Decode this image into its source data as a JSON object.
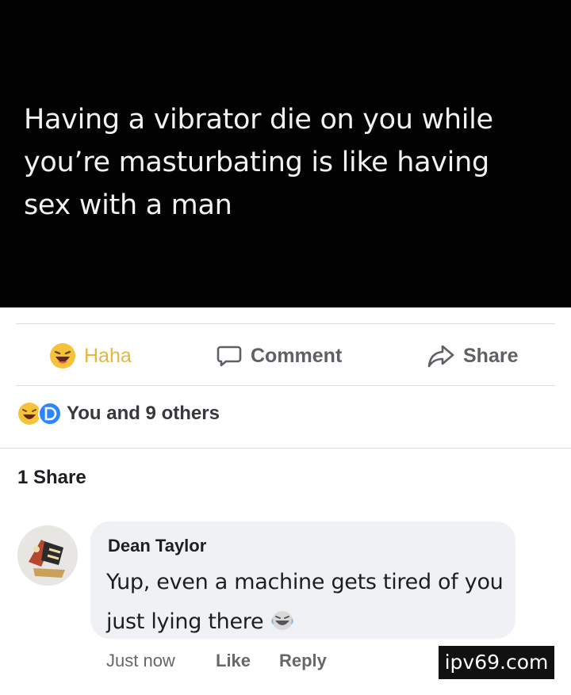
{
  "post": {
    "text": "Having a vibrator die on you while you’re masturbating is like having sex with a man"
  },
  "actions": {
    "haha_label": "Haha",
    "comment_label": "Comment",
    "share_label": "Share",
    "haha_color": "#e6b83a"
  },
  "reactions": {
    "summary": "You and 9 others",
    "icons": [
      "haha-emoji-icon",
      "d-avatar-badge-icon"
    ]
  },
  "shares": {
    "count_text": "1 Share"
  },
  "comment": {
    "author": "Dean Taylor",
    "text": "Yup, even a machine gets tired of you just lying there",
    "emoji": "laughing-emoji-icon",
    "time": "Just now",
    "like_label": "Like",
    "reply_label": "Reply"
  },
  "watermark": {
    "text": "ipv69.com"
  }
}
